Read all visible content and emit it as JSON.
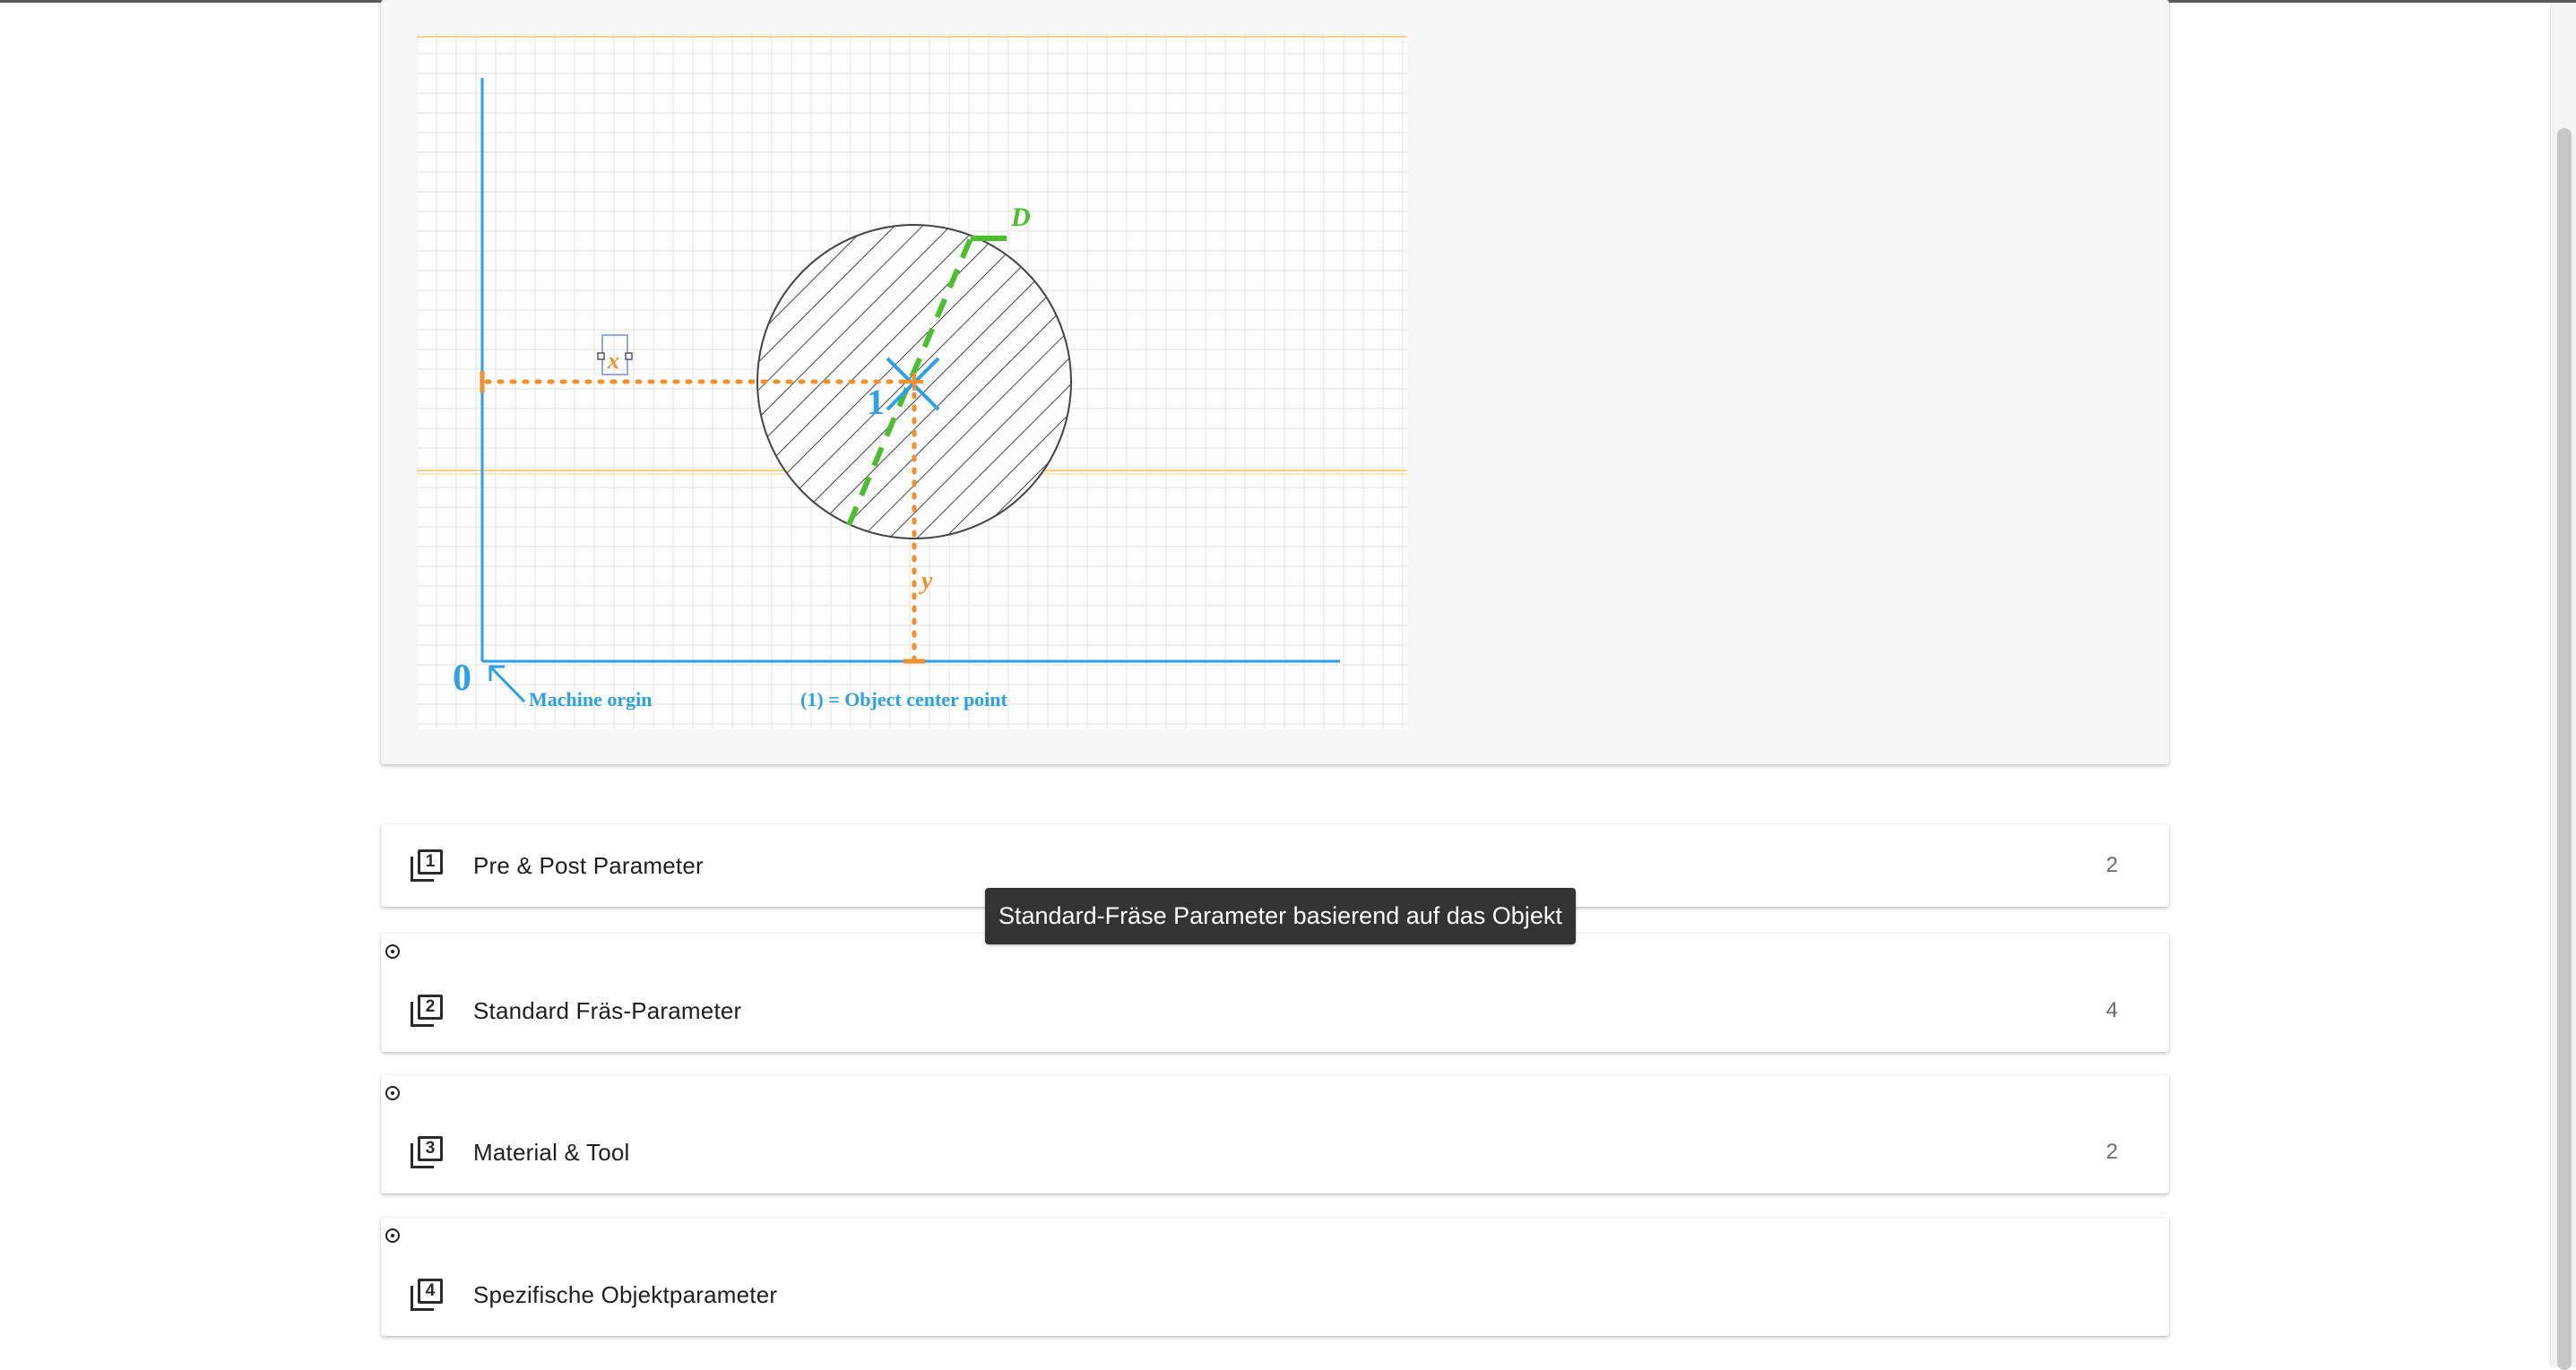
{
  "drawing": {
    "label_d": "D",
    "label_x": "x",
    "label_y": "y",
    "label_one": "1",
    "label_zero": "0",
    "machine_origin_label": "Machine orgin",
    "object_center_label": "(1) = Object center point",
    "colors": {
      "axis": "#2aa1e8",
      "dimension": "#f0902c",
      "diameter": "#4bbf2b",
      "hatch": "#444444",
      "grid": "#e2e2e2"
    }
  },
  "panels": [
    {
      "number": "1",
      "title": "Pre & Post Parameter",
      "count": "2",
      "has_radio": false
    },
    {
      "number": "2",
      "title": "Standard Fräs-Parameter",
      "count": "4",
      "has_radio": true
    },
    {
      "number": "3",
      "title": "Material & Tool",
      "count": "2",
      "has_radio": true
    },
    {
      "number": "4",
      "title": "Spezifische Objektparameter",
      "count": "",
      "has_radio": true
    }
  ],
  "tooltip": {
    "text": "Standard-Fräse Parameter basierend auf das Objekt"
  },
  "icons": {
    "panel_icon": "filter-number-icon",
    "radio_icon": "radio-target-icon"
  }
}
